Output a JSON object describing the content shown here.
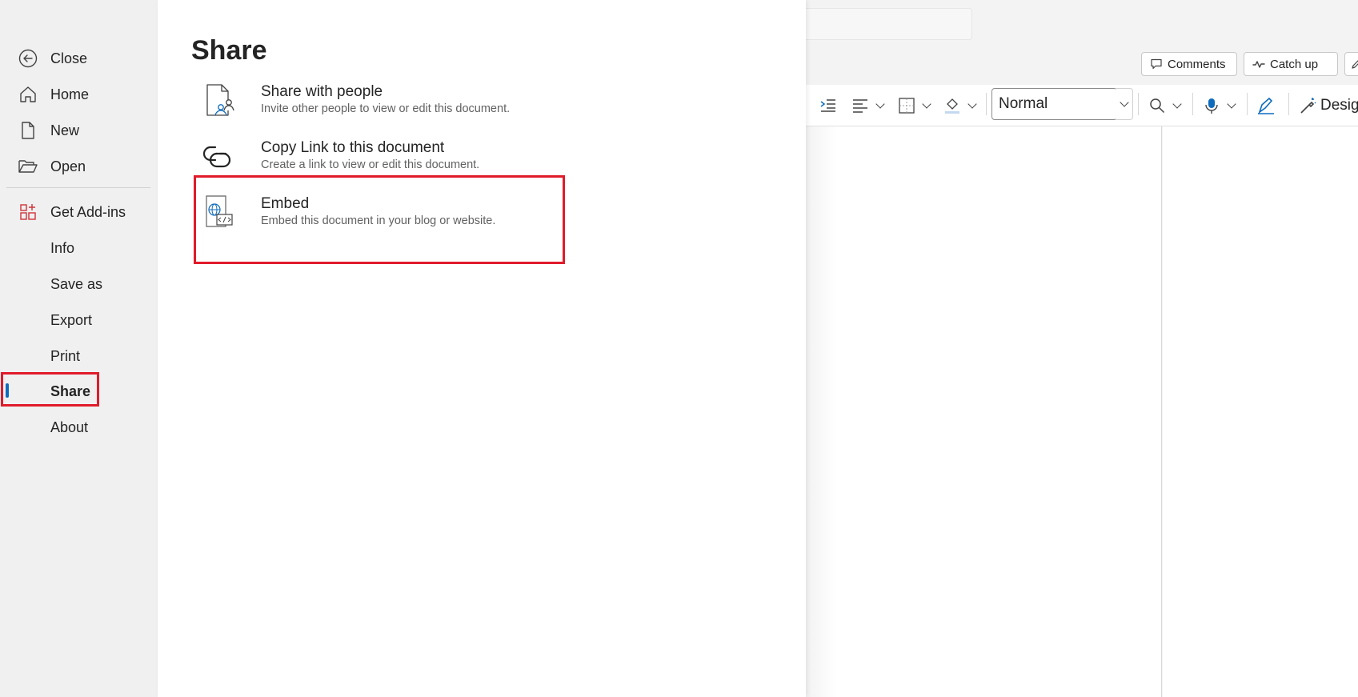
{
  "nav": {
    "items": [
      {
        "label": "Close",
        "icon": "back-arrow-circle-icon"
      },
      {
        "label": "Home",
        "icon": "home-icon"
      },
      {
        "label": "New",
        "icon": "new-document-icon"
      },
      {
        "label": "Open",
        "icon": "folder-open-icon"
      },
      {
        "label": "Get Add-ins",
        "icon": "add-ins-icon"
      },
      {
        "label": "Info"
      },
      {
        "label": "Save as"
      },
      {
        "label": "Export"
      },
      {
        "label": "Print"
      },
      {
        "label": "Share",
        "active": true
      },
      {
        "label": "About"
      }
    ]
  },
  "panel": {
    "title": "Share",
    "options": [
      {
        "title": "Share with people",
        "description": "Invite other people to view or edit this document.",
        "icon": "share-people-icon"
      },
      {
        "title": "Copy Link to this document",
        "description": "Create a link to view or edit this document.",
        "icon": "link-icon"
      },
      {
        "title": "Embed",
        "description": "Embed this document in your blog or website.",
        "icon": "embed-icon"
      }
    ]
  },
  "editor": {
    "comments_label": "Comments",
    "catchup_label": "Catch up",
    "style_value": "Normal",
    "designer_label": "Designer"
  },
  "colors": {
    "highlight": "#e01b2a",
    "accent": "#0f6cbd",
    "addins_icon": "#d13438"
  }
}
